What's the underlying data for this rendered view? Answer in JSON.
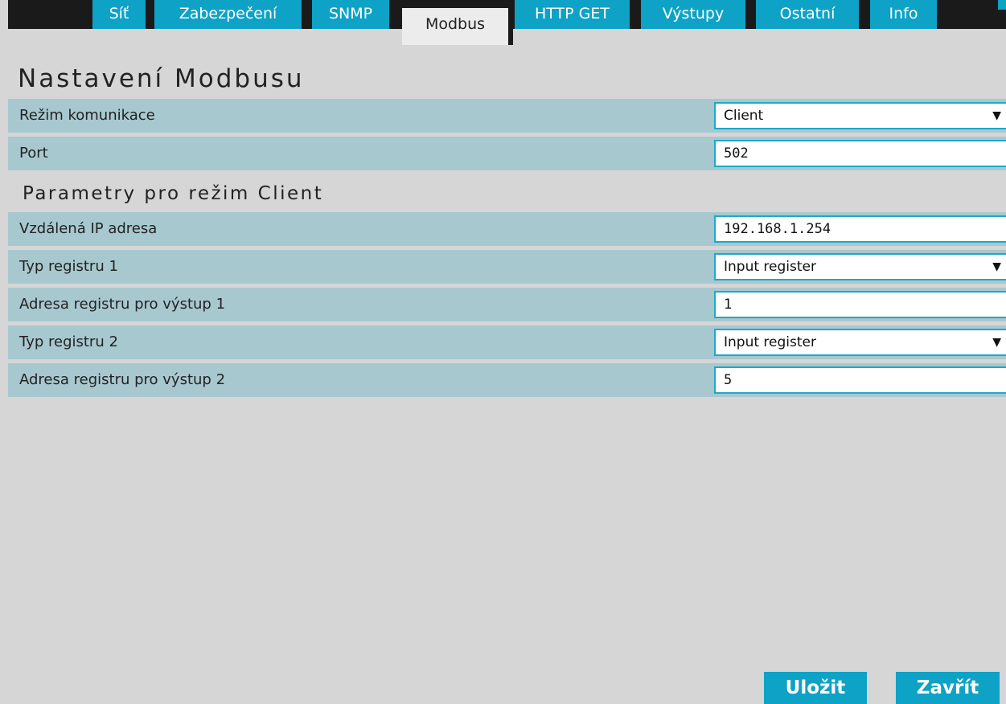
{
  "tabs": [
    {
      "label": "Síť"
    },
    {
      "label": "Zabezpečení"
    },
    {
      "label": "SNMP"
    },
    {
      "label": "Modbus",
      "active": true
    },
    {
      "label": "HTTP GET"
    },
    {
      "label": "Výstupy"
    },
    {
      "label": "Ostatní"
    },
    {
      "label": "Info"
    }
  ],
  "page_title": "Nastavení Modbusu",
  "general": {
    "mode": {
      "label": "Režim komunikace",
      "value": "Client"
    },
    "port": {
      "label": "Port",
      "value": "502"
    }
  },
  "client_section_title": "Parametry pro režim Client",
  "client": {
    "remote_ip": {
      "label": "Vzdálená IP adresa",
      "value": "192.168.1.254"
    },
    "reg_type_1": {
      "label": "Typ registru 1",
      "value": "Input register"
    },
    "reg_addr_1": {
      "label": "Adresa registru pro výstup 1",
      "value": "1"
    },
    "reg_type_2": {
      "label": "Typ registru 2",
      "value": "Input register"
    },
    "reg_addr_2": {
      "label": "Adresa registru pro výstup 2",
      "value": "5"
    }
  },
  "buttons": {
    "save": "Uložit",
    "close": "Zavřít"
  },
  "icons": {
    "dropdown": "caret-down-icon"
  },
  "colors": {
    "accent": "#0ea2c6",
    "row_bg": "#a8c8cf",
    "page_bg": "#d6d6d6",
    "tabbar_bg": "#1a1a1a"
  }
}
